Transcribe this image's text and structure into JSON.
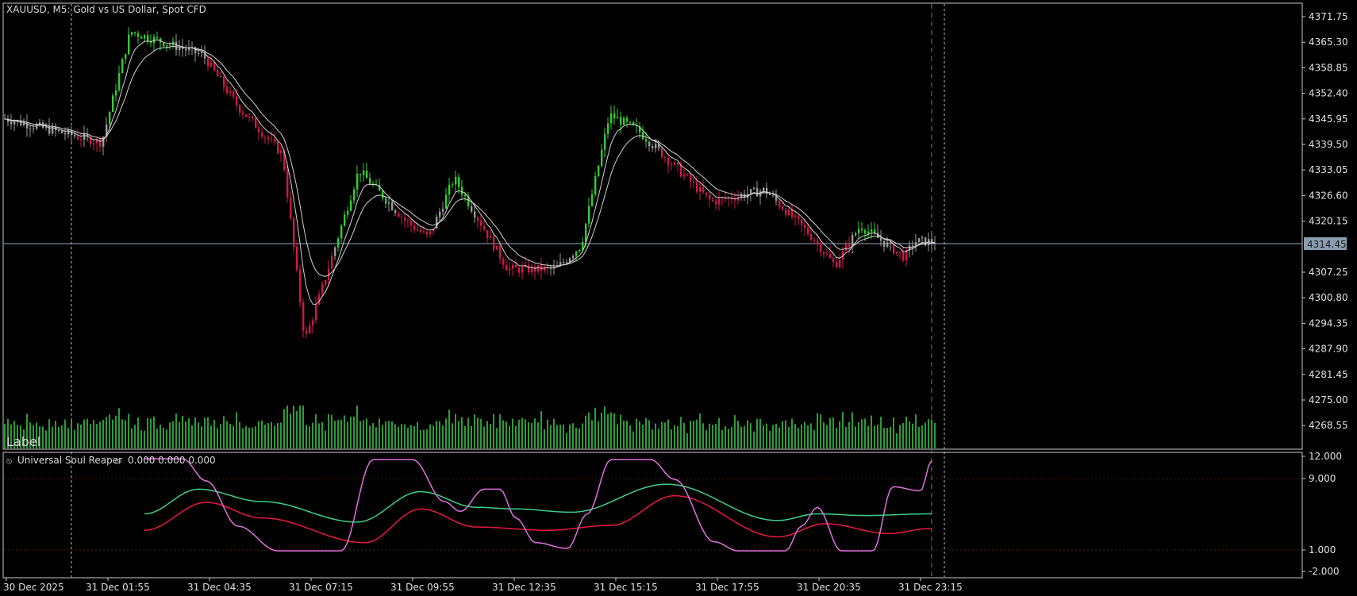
{
  "header": {
    "symbol_title": "XAUUSD, M5:  Gold vs US Dollar, Spot CFD",
    "label_text": "Label"
  },
  "indicator": {
    "title": "Universal Soul Reaper",
    "values": "0.000 0.000 0.000",
    "levels": [
      "12.000",
      "9.000",
      "1.000",
      "-2.000"
    ]
  },
  "price_axis": {
    "ticks": [
      "4371.75",
      "4365.30",
      "4358.85",
      "4352.40",
      "4345.95",
      "4339.50",
      "4333.05",
      "4326.60",
      "4320.15",
      "4307.25",
      "4300.80",
      "4294.35",
      "4287.90",
      "4281.45",
      "4275.00",
      "4268.55"
    ],
    "current_price": "4314.45"
  },
  "time_axis": {
    "labels": [
      "30 Dec 2025",
      "31 Dec 01:55",
      "31 Dec 04:35",
      "31 Dec 07:15",
      "31 Dec 09:55",
      "31 Dec 12:35",
      "31 Dec 15:15",
      "31 Dec 17:55",
      "31 Dec 20:35",
      "31 Dec 23:15"
    ]
  },
  "colors": {
    "background": "#000000",
    "grid_frame": "#c8c8c8",
    "bull_candle": "#33cc33",
    "bear_candle": "#cc1a4a",
    "neutral_candle": "#9a9a9a",
    "volume": "#2e9b3a",
    "ma_line": "#d0d0d0",
    "osc_green": "#3ccf88",
    "osc_red": "#e8193c",
    "osc_pink": "#e070e0",
    "current_price_bg": "#8a9db0"
  },
  "chart_data": {
    "type": "candlestick",
    "price_path": [
      {
        "t": "30 Dec 2025",
        "p": 4346
      },
      {
        "t": "31 Dec 01:55",
        "p": 4340
      },
      {
        "t": "31 Dec 02:40",
        "p": 4368
      },
      {
        "t": "31 Dec 04:35",
        "p": 4362
      },
      {
        "t": "31 Dec 05:30",
        "p": 4349
      },
      {
        "t": "31 Dec 06:40",
        "p": 4337
      },
      {
        "t": "31 Dec 07:15",
        "p": 4290
      },
      {
        "t": "31 Dec 07:40",
        "p": 4302
      },
      {
        "t": "31 Dec 08:40",
        "p": 4333
      },
      {
        "t": "31 Dec 09:55",
        "p": 4320
      },
      {
        "t": "31 Dec 10:30",
        "p": 4316
      },
      {
        "t": "31 Dec 11:10",
        "p": 4331
      },
      {
        "t": "31 Dec 12:35",
        "p": 4308
      },
      {
        "t": "31 Dec 13:50",
        "p": 4308
      },
      {
        "t": "31 Dec 14:30",
        "p": 4314
      },
      {
        "t": "31 Dec 15:15",
        "p": 4347
      },
      {
        "t": "31 Dec 16:00",
        "p": 4343
      },
      {
        "t": "31 Dec 17:55",
        "p": 4325
      },
      {
        "t": "31 Dec 19:20",
        "p": 4328
      },
      {
        "t": "31 Dec 20:35",
        "p": 4316
      },
      {
        "t": "31 Dec 21:10",
        "p": 4309
      },
      {
        "t": "31 Dec 21:50",
        "p": 4319
      },
      {
        "t": "31 Dec 23:00",
        "p": 4311
      },
      {
        "t": "31 Dec 23:15",
        "p": 4315
      }
    ],
    "ylim": [
      4265,
      4375
    ],
    "oscillator_ylim": [
      -2,
      12
    ]
  }
}
